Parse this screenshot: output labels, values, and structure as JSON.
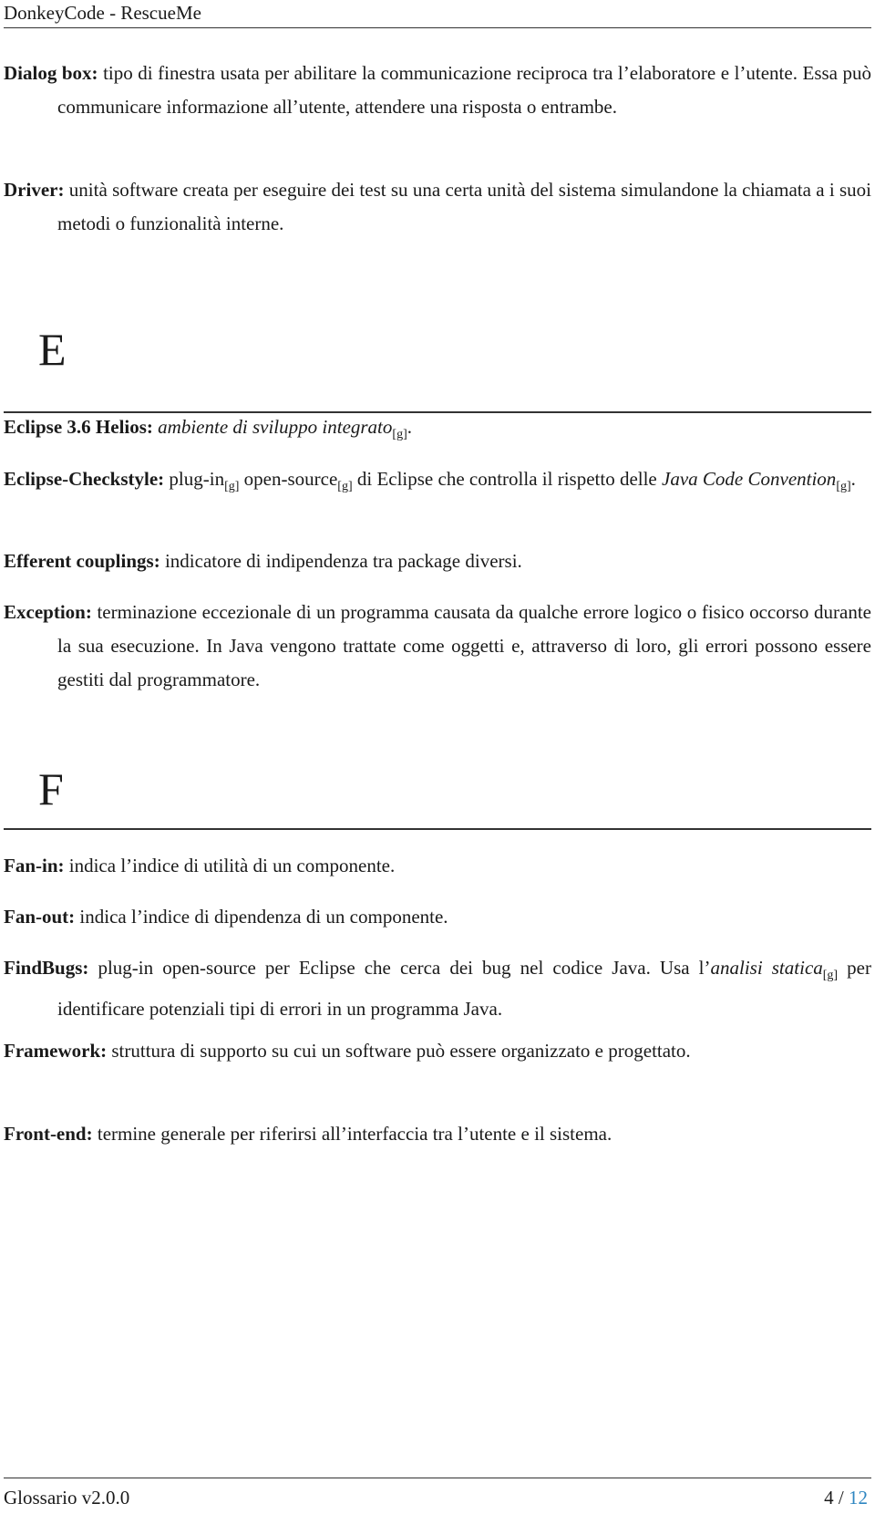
{
  "header": {
    "title": "DonkeyCode - RescueMe"
  },
  "entries_d": [
    {
      "term": "Dialog box:",
      "text": "tipo di finestra usata per abilitare la communicazione reciproca tra l’elaboratore e l’utente. Essa può communicare informazione all’utente, attendere una risposta o entrambe."
    },
    {
      "term": "Driver:",
      "text": "unità software creata per eseguire dei test su una certa unità del sistema simulandone la chiamata a i suoi metodi o funzionalità interne."
    }
  ],
  "section_e": {
    "letter": "E",
    "eclipse": {
      "term": "Eclipse 3.6 Helios:",
      "italic": "ambiente di sviluppo integrato",
      "sub": "[g]",
      "end": "."
    },
    "checkstyle": {
      "term": "Eclipse-Checkstyle:",
      "t1": "plug-in",
      "s1": "[g]",
      "t2": " open-source",
      "s2": "[g]",
      "t3": " di Eclipse che controlla il rispetto delle ",
      "italic": "Java Code Convention",
      "s3": "[g]",
      "end": "."
    },
    "efferent": {
      "term": "Efferent couplings:",
      "text": "indicatore di indipendenza tra package diversi."
    },
    "exception": {
      "term": "Exception:",
      "text": "terminazione eccezionale di un programma causata da qualche errore logico o fisico occorso durante la sua esecuzione. In Java vengono trattate come oggetti e, attraverso di loro, gli errori possono essere gestiti dal programmatore."
    }
  },
  "section_f": {
    "letter": "F",
    "fanin": {
      "term": "Fan-in:",
      "text": "indica l’indice di utilità di un componente."
    },
    "fanout": {
      "term": "Fan-out:",
      "text": "indica l’indice di dipendenza di un componente."
    },
    "findbugs": {
      "term": "FindBugs:",
      "t1": "plug-in open-source per Eclipse che cerca dei bug nel codice Java. Usa l’",
      "italic": "analisi statica",
      "sub": "[g]",
      "t2": " per identificare potenziali tipi di errori in un programma Java."
    },
    "framework": {
      "term": "Framework:",
      "text": "struttura di supporto su cui un software può essere organizzato e progettato."
    },
    "frontend": {
      "term": "Front-end:",
      "text": "termine generale per riferirsi all’interfaccia tra l’utente e il sistema."
    }
  },
  "footer": {
    "doc_version": "Glossario v2.0.0",
    "current_page": "4",
    "separator": " / ",
    "total_pages": "12"
  }
}
